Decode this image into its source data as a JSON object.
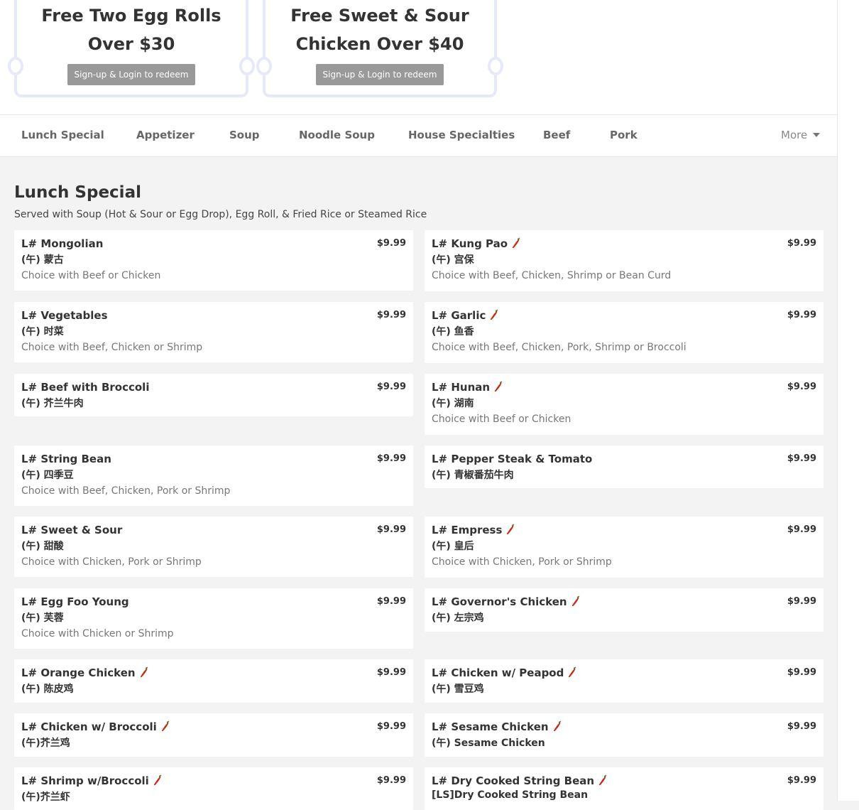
{
  "coupons": [
    {
      "title_line1": "Free Two Egg Rolls",
      "title_line2": "Over $30",
      "button": "Sign-up & Login to redeem"
    },
    {
      "title_line1": "Free Sweet & Sour",
      "title_line2": "Chicken Over $40",
      "button": "Sign-up & Login to redeem"
    }
  ],
  "nav": {
    "items": [
      "Lunch Special",
      "Appetizer",
      "Soup",
      "Noodle Soup",
      "House Specialties",
      "Beef",
      "Pork"
    ],
    "more": "More"
  },
  "section": {
    "title": "Lunch Special",
    "description": "Served with Soup (Hot & Sour or Egg Drop), Egg Roll, & Fried Rice or Steamed Rice"
  },
  "menu_items": [
    {
      "name": "L# Mongolian",
      "sub": "(午) 蒙古",
      "desc": "Choice with Beef or Chicken",
      "price": "$9.99",
      "spicy": false
    },
    {
      "name": "L# Kung Pao",
      "sub": "(午) 宫保",
      "desc": "Choice with Beef, Chicken, Shrimp or Bean Curd",
      "price": "$9.99",
      "spicy": true
    },
    {
      "name": "L# Vegetables",
      "sub": "(午) 时菜",
      "desc": "Choice with Beef, Chicken or Shrimp",
      "price": "$9.99",
      "spicy": false
    },
    {
      "name": "L# Garlic",
      "sub": "(午) 鱼香",
      "desc": "Choice with Beef, Chicken, Pork, Shrimp or Broccoli",
      "price": "$9.99",
      "spicy": true
    },
    {
      "name": "L# Beef with Broccoli",
      "sub": "(午) 芥兰牛肉",
      "desc": "",
      "price": "$9.99",
      "spicy": false
    },
    {
      "name": "L# Hunan",
      "sub": "(午) 湖南",
      "desc": "Choice with Beef or Chicken",
      "price": "$9.99",
      "spicy": true
    },
    {
      "name": "L# String Bean",
      "sub": "(午) 四季豆",
      "desc": "Choice with Beef, Chicken, Pork or Shrimp",
      "price": "$9.99",
      "spicy": false
    },
    {
      "name": "L# Pepper Steak & Tomato",
      "sub": "(午) 青椒番茄牛肉",
      "desc": "",
      "price": "$9.99",
      "spicy": false
    },
    {
      "name": "L# Sweet & Sour",
      "sub": "(午) 甜酸",
      "desc": "Choice with Chicken, Pork or Shrimp",
      "price": "$9.99",
      "spicy": false
    },
    {
      "name": "L# Empress",
      "sub": "(午) 皇后",
      "desc": "Choice with Chicken, Pork or Shrimp",
      "price": "$9.99",
      "spicy": true
    },
    {
      "name": "L# Egg Foo Young",
      "sub": "(午) 芙蓉",
      "desc": "Choice with Chicken or Shrimp",
      "price": "$9.99",
      "spicy": false
    },
    {
      "name": "L# Governor's Chicken",
      "sub": "(午) 左宗鸡",
      "desc": "",
      "price": "$9.99",
      "spicy": true
    },
    {
      "name": "L# Orange Chicken",
      "sub": "(午) 陈皮鸡",
      "desc": "",
      "price": "$9.99",
      "spicy": true
    },
    {
      "name": "L# Chicken w/ Peapod",
      "sub": "(午) 雪豆鸡",
      "desc": "",
      "price": "$9.99",
      "spicy": true
    },
    {
      "name": "L# Chicken w/ Broccoli",
      "sub": "(午)芥兰鸡",
      "desc": "",
      "price": "$9.99",
      "spicy": true
    },
    {
      "name": "L# Sesame Chicken",
      "sub": "(午) Sesame Chicken",
      "desc": "",
      "price": "$9.99",
      "spicy": true
    },
    {
      "name": "L# Shrimp w/Broccoli",
      "sub": "(午)芥兰虾",
      "desc": "",
      "price": "$9.99",
      "spicy": true
    },
    {
      "name": "L# Dry Cooked String Bean",
      "sub": "[LS]Dry Cooked String Bean",
      "desc": "",
      "price": "$9.99",
      "spicy": true
    }
  ],
  "colors": {
    "chili": "#c4290f",
    "price_text": "#333333",
    "button_bg": "#999999"
  }
}
